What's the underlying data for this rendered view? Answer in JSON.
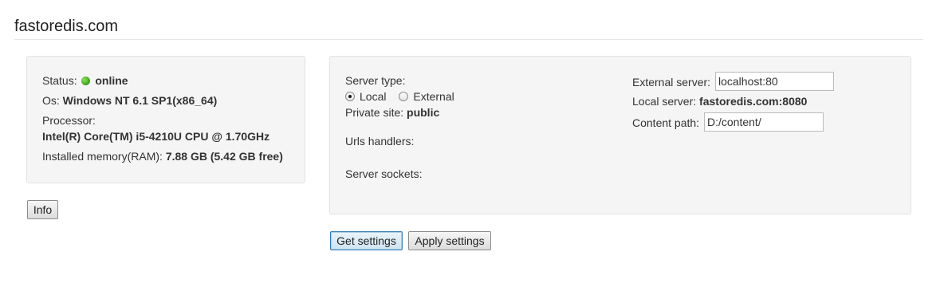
{
  "header": {
    "title": "fastoredis.com"
  },
  "system": {
    "status_label": "Status:",
    "status_value": "online",
    "os_label": "Os:",
    "os_value": "Windows NT 6.1 SP1(x86_64)",
    "processor_label": "Processor:",
    "processor_value": "Intel(R) Core(TM) i5-4210U CPU @ 1.70GHz",
    "memory_label": "Installed memory(RAM):",
    "memory_value": "7.88 GB (5.42 GB free)",
    "info_button": "Info",
    "status_color": "#3a9d1c"
  },
  "server": {
    "type_label": "Server type:",
    "type_options": [
      {
        "label": "Local",
        "checked": true
      },
      {
        "label": "External",
        "checked": false
      }
    ],
    "private_site_label": "Private site:",
    "private_site_value": "public",
    "urls_handlers_label": "Urls handlers:",
    "server_sockets_label": "Server sockets:",
    "external_server_label": "External server:",
    "external_server_value": "localhost:80",
    "local_server_label": "Local server:",
    "local_server_value": "fastoredis.com:8080",
    "content_path_label": "Content path:",
    "content_path_value": "D:/content/"
  },
  "actions": {
    "get_settings": "Get settings",
    "apply_settings": "Apply settings"
  }
}
